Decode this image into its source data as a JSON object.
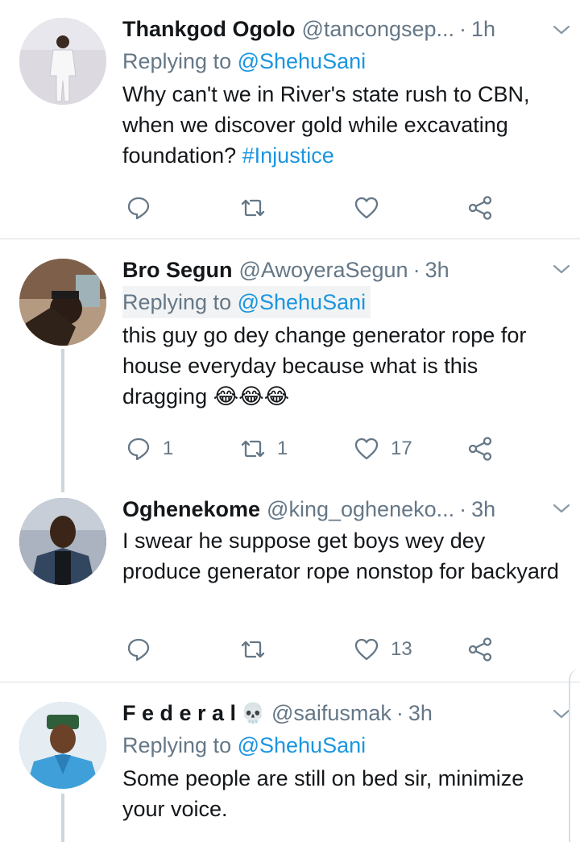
{
  "tweets": [
    {
      "name": "Thankgod Ogolo",
      "handle": "@tancongsep...",
      "separator": "·",
      "time": "1h",
      "replying_prefix": "Replying to ",
      "replying_to": "@ShehuSani",
      "text": "Why can't we in River's state rush to CBN, when we discover gold while excavating foundation? ",
      "hashtag": "#Injustice",
      "replies": "",
      "retweets": "",
      "likes": ""
    },
    {
      "name": "Bro Segun",
      "handle": "@AwoyeraSegun",
      "separator": "·",
      "time": "3h",
      "replying_prefix": "Replying to ",
      "replying_to": "@ShehuSani",
      "text": "this guy go dey change generator rope for house everyday because what is this dragging 😂😂😂",
      "replies": "1",
      "retweets": "1",
      "likes": "17"
    },
    {
      "name": "Oghenekome",
      "handle": "@king_ogheneko...",
      "separator": "·",
      "time": "3h",
      "text": "I swear he suppose get boys wey dey produce generator rope nonstop for backyard",
      "replies": "",
      "retweets": "",
      "likes": "13"
    },
    {
      "name": "F e d e r a l",
      "name_emoji": "💀",
      "handle": "@saifusmak",
      "separator": "·",
      "time": "3h",
      "replying_prefix": "Replying to ",
      "replying_to": "@ShehuSani",
      "text": "Some people are still on bed sir, minimize your voice."
    }
  ],
  "icons": {
    "reply": "reply-icon",
    "retweet": "retweet-icon",
    "like": "heart-icon",
    "share": "share-icon",
    "caret": "chevron-down-icon"
  },
  "colors": {
    "link": "#1b95e0",
    "secondary": "#657786",
    "divider": "#d9dee2",
    "thread_line": "#ccd6dd"
  }
}
